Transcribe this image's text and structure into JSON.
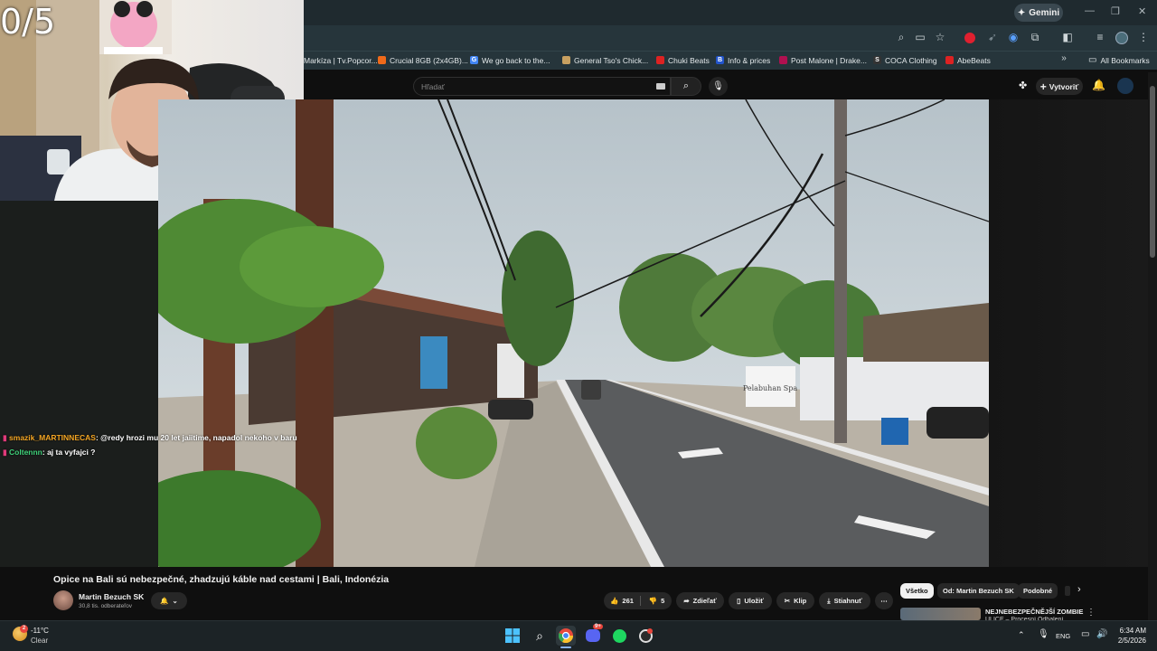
{
  "stream": {
    "counter": "0/5"
  },
  "browser": {
    "gemini_label": "Gemini",
    "bookmarks": [
      {
        "label": "Markíza | Tv.Popcor...",
        "color": "#e33"
      },
      {
        "label": "Crucial 8GB (2x4GB)...",
        "color": "#f06a1a"
      },
      {
        "label": "We go back to the...",
        "color": "#4285f4",
        "glyph": "G"
      },
      {
        "label": "General Tso's Chick...",
        "color": "#c8a060"
      },
      {
        "label": "Chuki Beats",
        "color": "#d22"
      },
      {
        "label": "Info & prices",
        "color": "#2255cc",
        "glyph": "B"
      },
      {
        "label": "Post Malone | Drake...",
        "color": "#b01050"
      },
      {
        "label": "COCA Clothing",
        "color": "#333",
        "glyph": "S"
      },
      {
        "label": "AbeBeats",
        "color": "#d22"
      }
    ],
    "all_bookmarks": "All Bookmarks"
  },
  "youtube": {
    "search_placeholder": "Hľadať",
    "create_label": "Vytvoriť",
    "video_title": "Opice na Bali sú nebezpečné, zhadzujú káble nad cestami | Bali, Indonézia",
    "channel_name": "Martin Bezuch SK",
    "channel_subs": "30,8 tis. odberateľov",
    "likes": "261",
    "dislikes": "5",
    "share": "Zdieľať",
    "save": "Uložiť",
    "clip": "Klip",
    "download": "Stiahnuť",
    "chips": [
      "Všetko",
      "Od: Martin Bezuch SK",
      "Podobné"
    ],
    "next_video_title": "NEJNEBEZPEČNĚJŠÍ ZOMBIE",
    "next_video_sub": "ULICE – Procesní Odhalení..."
  },
  "chat": [
    {
      "user": "smazik_MARTINNECAS",
      "msg": ": @redy hrozi mu 20 let jaiitime, napadol nekoho v baru",
      "color": "#f5a623"
    },
    {
      "user": "Coltennn",
      "msg": ": aj ta vyfajci ?",
      "color": "#3fd27a"
    }
  ],
  "video_scene": {
    "sign_text": "Pelabuhan Spa"
  },
  "taskbar": {
    "weather_temp": "-11°C",
    "weather_desc": "Clear",
    "weather_badge": "2",
    "discord_badge": "9+",
    "lang": "ENG",
    "time": "6:34 AM",
    "date": "2/5/2026"
  }
}
